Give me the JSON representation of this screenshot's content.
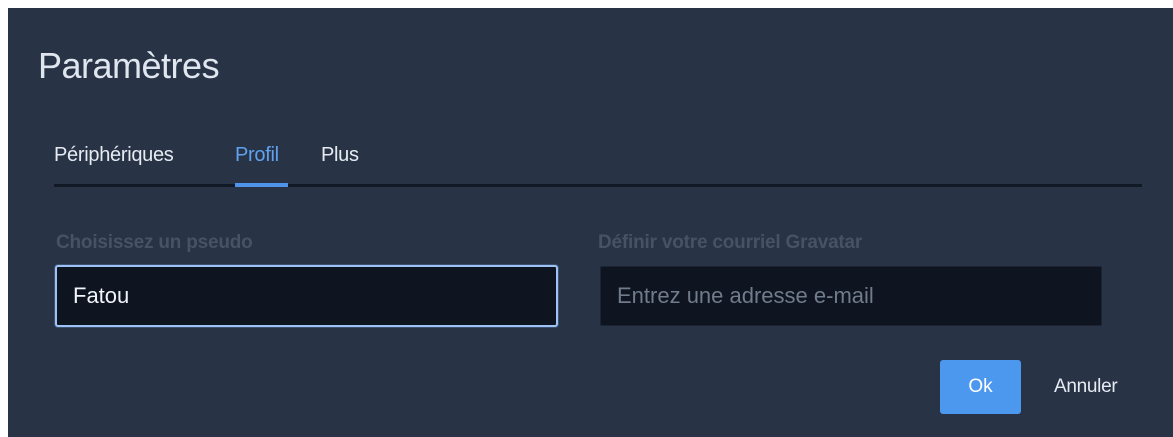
{
  "dialog": {
    "title": "Paramètres"
  },
  "tabs": [
    {
      "label": "Périphériques",
      "active": false
    },
    {
      "label": "Profil",
      "active": true
    },
    {
      "label": "Plus",
      "active": false
    }
  ],
  "profile": {
    "nickname_label": "Choisissez un pseudo",
    "nickname_value": "Fatou",
    "gravatar_label": "Définir votre courriel Gravatar",
    "gravatar_value": "",
    "gravatar_placeholder": "Entrez une adresse e-mail"
  },
  "actions": {
    "ok_label": "Ok",
    "cancel_label": "Annuler"
  },
  "colors": {
    "background": "#283345",
    "accent": "#4b98ee",
    "active_tab": "#5fa2ef",
    "input_background": "#0e1420"
  }
}
